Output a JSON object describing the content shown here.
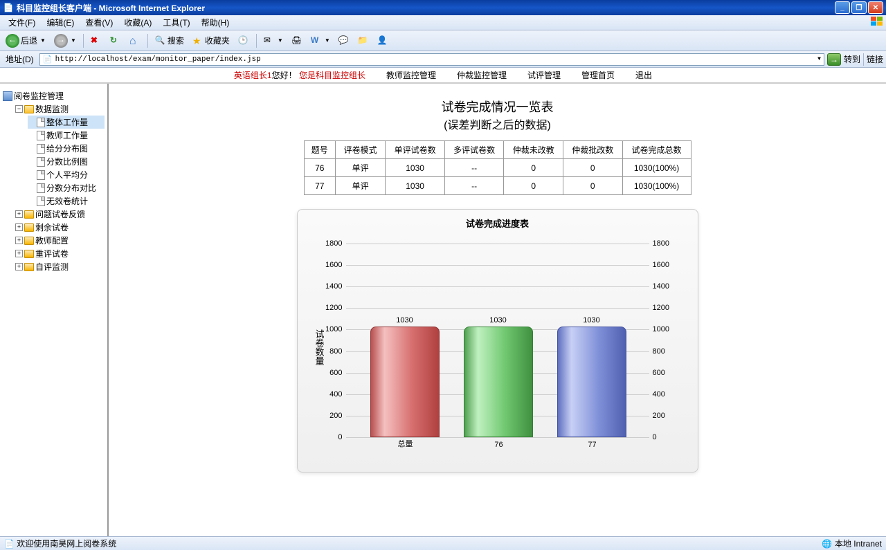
{
  "window": {
    "title": "科目监控组长客户端 - Microsoft Internet Explorer"
  },
  "menu": {
    "file": "文件(F)",
    "edit": "编辑(E)",
    "view": "查看(V)",
    "favorites": "收藏(A)",
    "tools": "工具(T)",
    "help": "帮助(H)"
  },
  "toolbar": {
    "back": "后退",
    "search": "搜索",
    "favorites": "收藏夹"
  },
  "address": {
    "label": "地址(D)",
    "url": "http://localhost/exam/monitor_paper/index.jsp",
    "go": "转到",
    "links": "链接"
  },
  "nav": {
    "greeting_prefix": "英语组长1",
    "greeting_mid": "您好！",
    "greeting_role": "您是科目监控组长",
    "items": [
      "教师监控管理",
      "仲裁监控管理",
      "试评管理",
      "管理首页",
      "退出"
    ]
  },
  "tree": {
    "root": "阅卷监控管理",
    "data_monitor": "数据监测",
    "data_monitor_children": [
      "整体工作量",
      "教师工作量",
      "给分分布图",
      "分数比例图",
      "个人平均分",
      "分数分布对比",
      "无效卷统计"
    ],
    "others": [
      "问题试卷反馈",
      "剩余试卷",
      "教师配置",
      "重评试卷",
      "自评监测"
    ]
  },
  "main": {
    "title1": "试卷完成情况一览表",
    "title2": "(误差判断之后的数据)",
    "table": {
      "headers": [
        "题号",
        "评卷模式",
        "单评试卷数",
        "多评试卷数",
        "仲裁未改教",
        "仲裁批改数",
        "试卷完成总数"
      ],
      "rows": [
        [
          "76",
          "单评",
          "1030",
          "--",
          "0",
          "0",
          "1030(100%)"
        ],
        [
          "77",
          "单评",
          "1030",
          "--",
          "0",
          "0",
          "1030(100%)"
        ]
      ]
    }
  },
  "chart_data": {
    "type": "bar",
    "title": "试卷完成进度表",
    "ylabel": "试卷数量",
    "ylim": [
      0,
      1800
    ],
    "ticks": [
      0,
      200,
      400,
      600,
      800,
      1000,
      1200,
      1400,
      1600,
      1800
    ],
    "categories": [
      "总量",
      "76",
      "77"
    ],
    "values": [
      1030,
      1030,
      1030
    ],
    "colors": [
      "#c86060",
      "#60b060",
      "#7080d0"
    ]
  },
  "status": {
    "left": "欢迎使用南昊网上阅卷系统",
    "right": "本地 Intranet"
  }
}
